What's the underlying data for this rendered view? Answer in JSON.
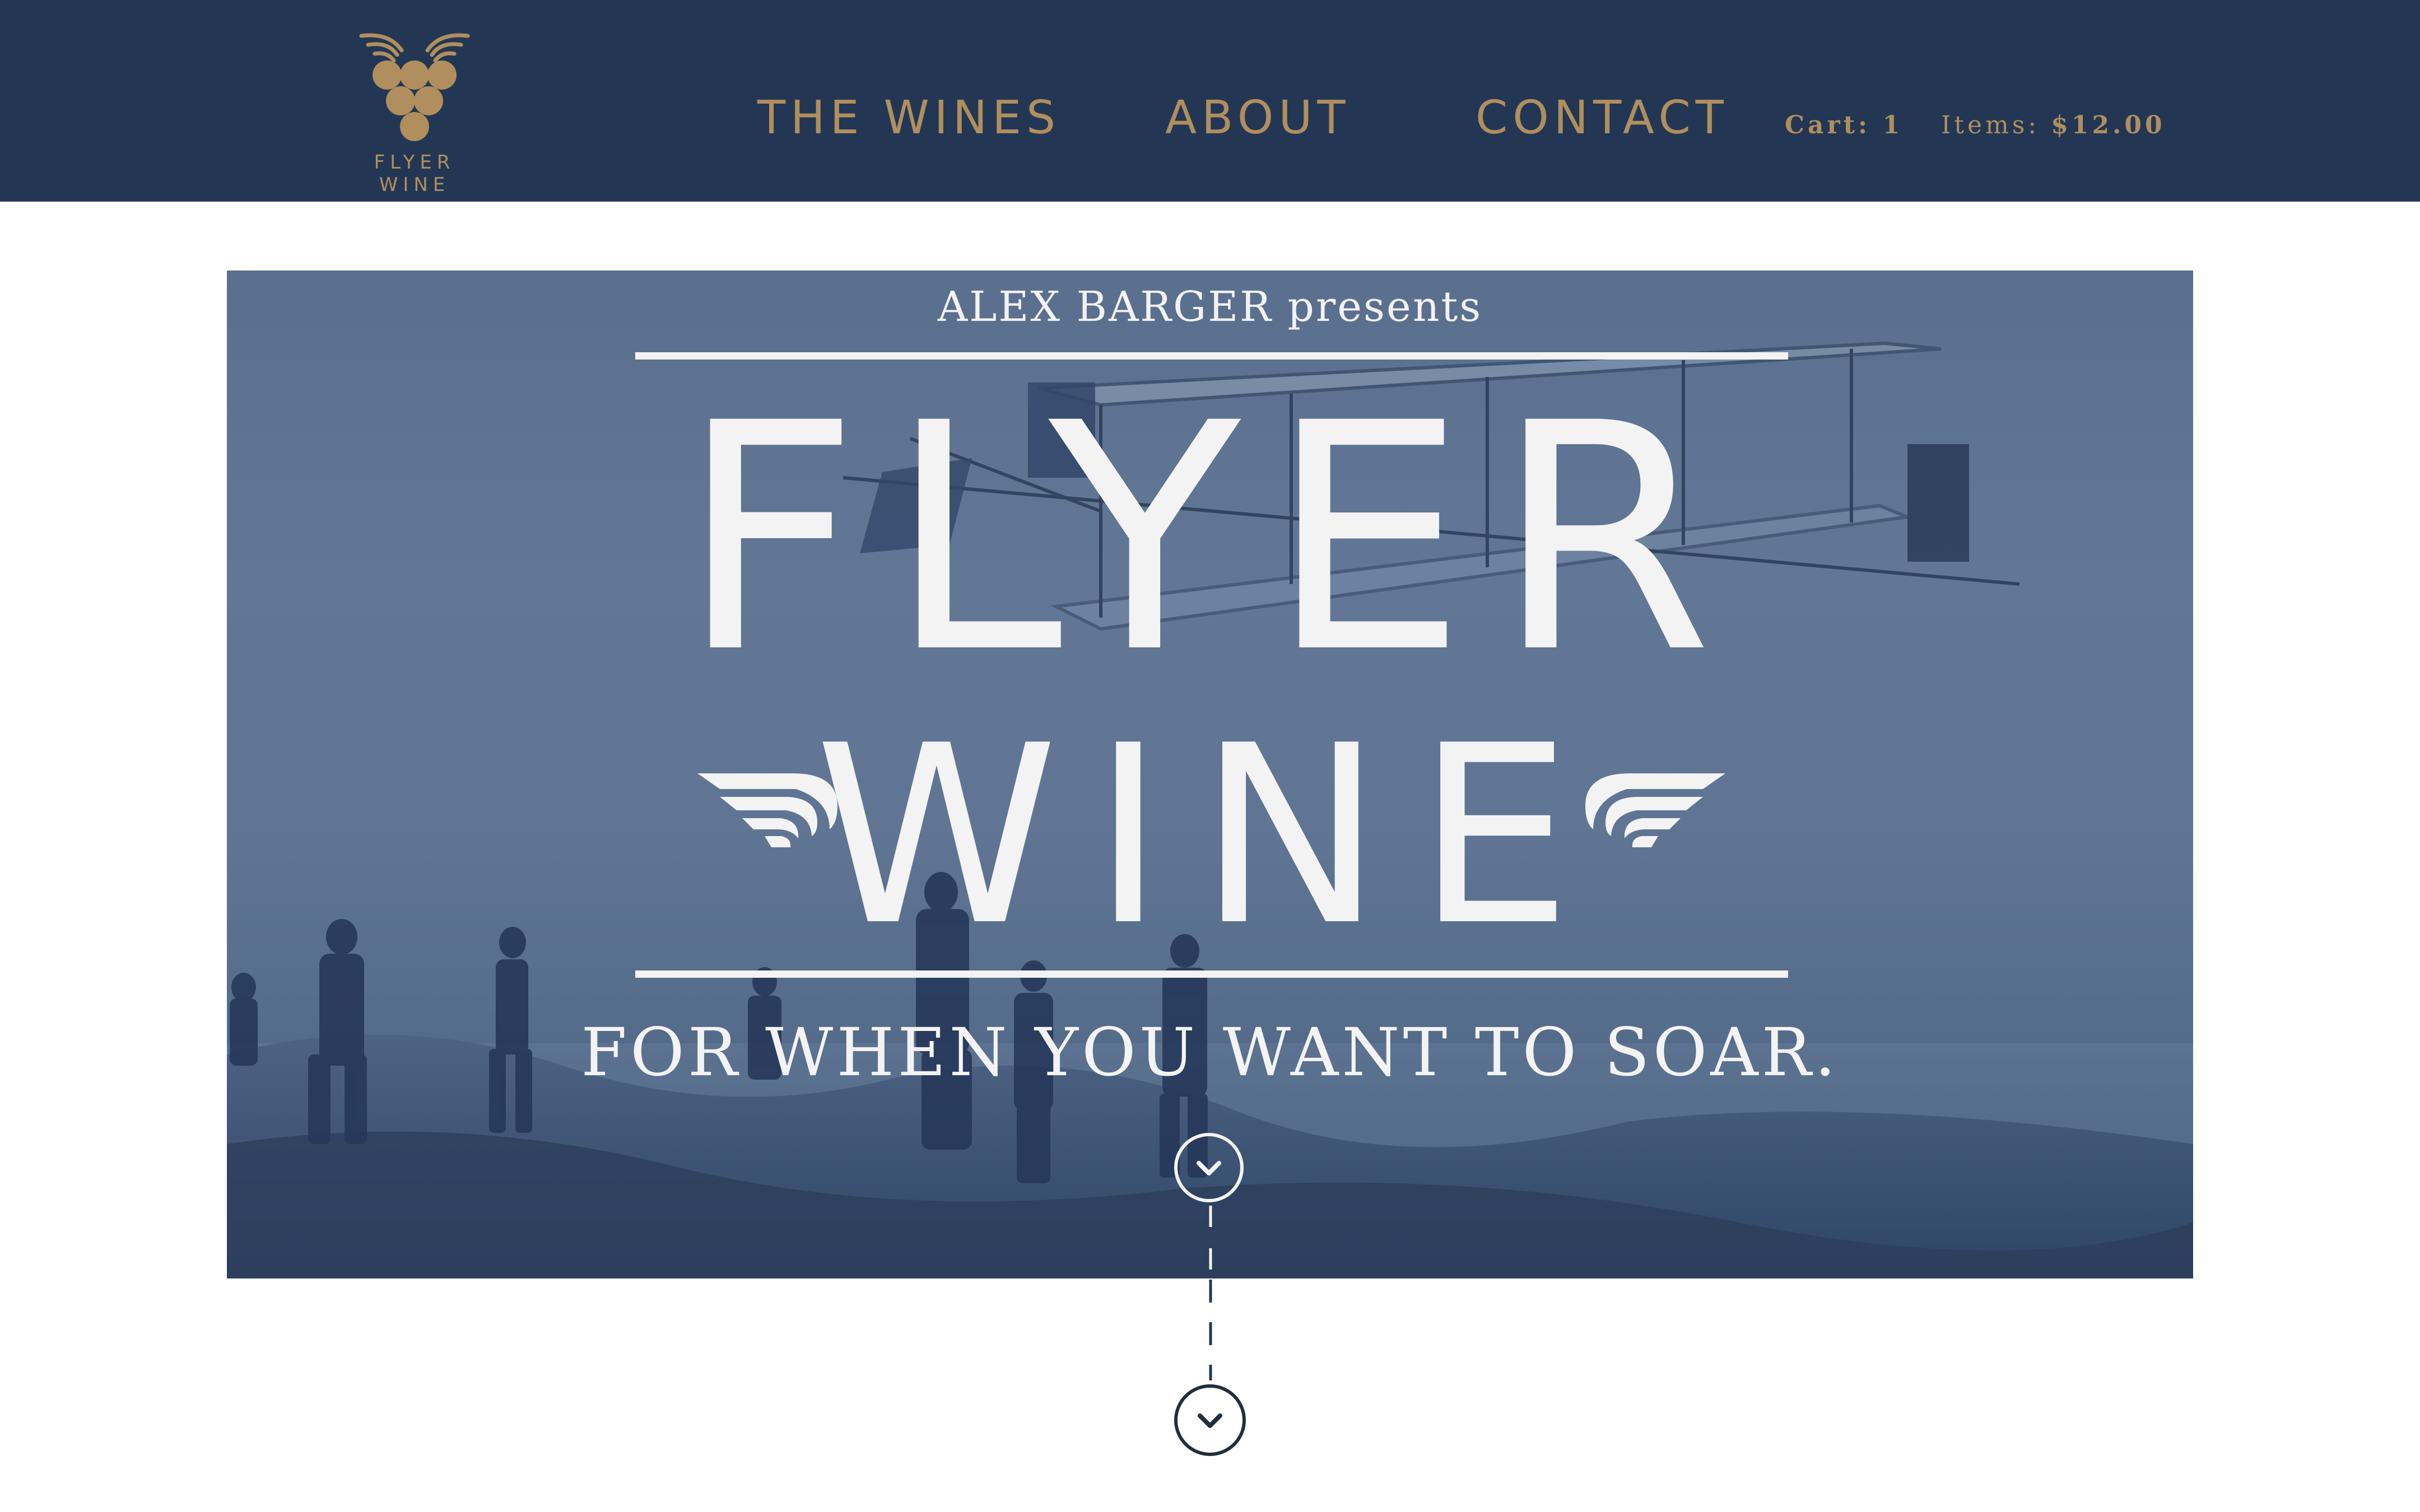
{
  "header": {
    "logo_text": "FLYER WINE",
    "nav": {
      "wines": "THE WINES",
      "about": "ABOUT",
      "contact": "CONTACT"
    },
    "cart": {
      "count_label": "Cart: 1",
      "items_label": "Items:",
      "items_total": "$12.00"
    }
  },
  "hero": {
    "presents": "ALEX BARGER presents",
    "title_line1": "FLYER",
    "title_line2": "WINE",
    "tagline": "FOR WHEN YOU WANT TO SOAR."
  },
  "icons": {
    "logo": "grape-wings-icon",
    "hero_scroll": "chevron-down-icon",
    "bottom_scroll": "chevron-down-icon"
  },
  "colors": {
    "header_bg": "#233755",
    "accent_gold": "#b08e5d",
    "hero_tint": "#5f7593",
    "hero_text": "#f3f3f3",
    "dark_line": "#222d3d"
  }
}
